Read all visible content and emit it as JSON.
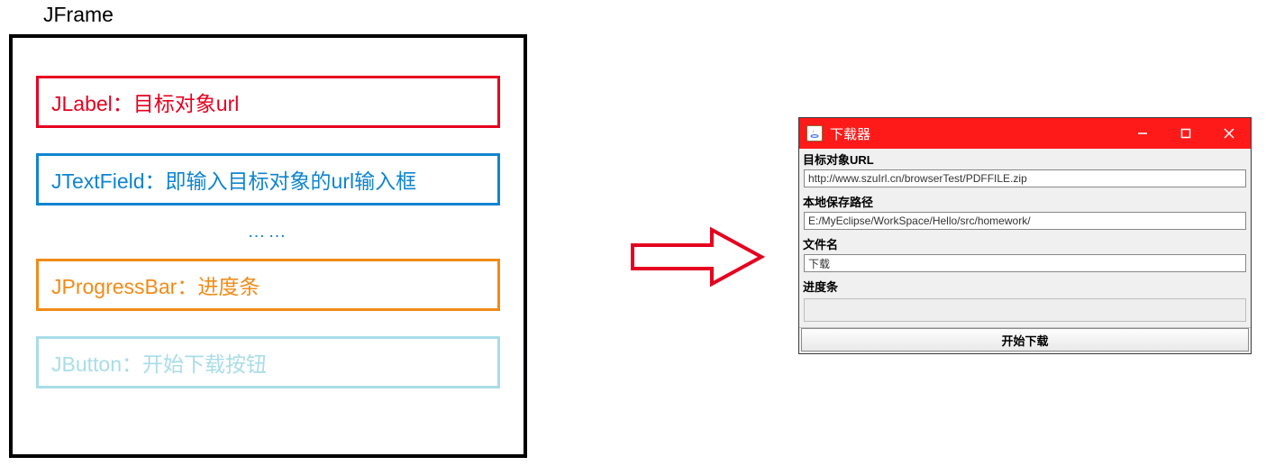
{
  "diagram": {
    "title": "JFrame",
    "jlabel": "JLabel：目标对象url",
    "jtextfield": "JTextField：即输入目标对象的url输入框",
    "ellipsis": "……",
    "jprogressbar": "JProgressBar：进度条",
    "jbutton": "JButton：开始下载按钮"
  },
  "app": {
    "title": "下载器",
    "labels": {
      "url": "目标对象URL",
      "path": "本地保存路径",
      "filename": "文件名",
      "progress": "进度条"
    },
    "values": {
      "url": "http://www.szuIrl.cn/browserTest/PDFFILE.zip",
      "path": "E:/MyEclipse/WorkSpace/Hello/src/homework/",
      "filename": "下载"
    },
    "button": "开始下载"
  }
}
